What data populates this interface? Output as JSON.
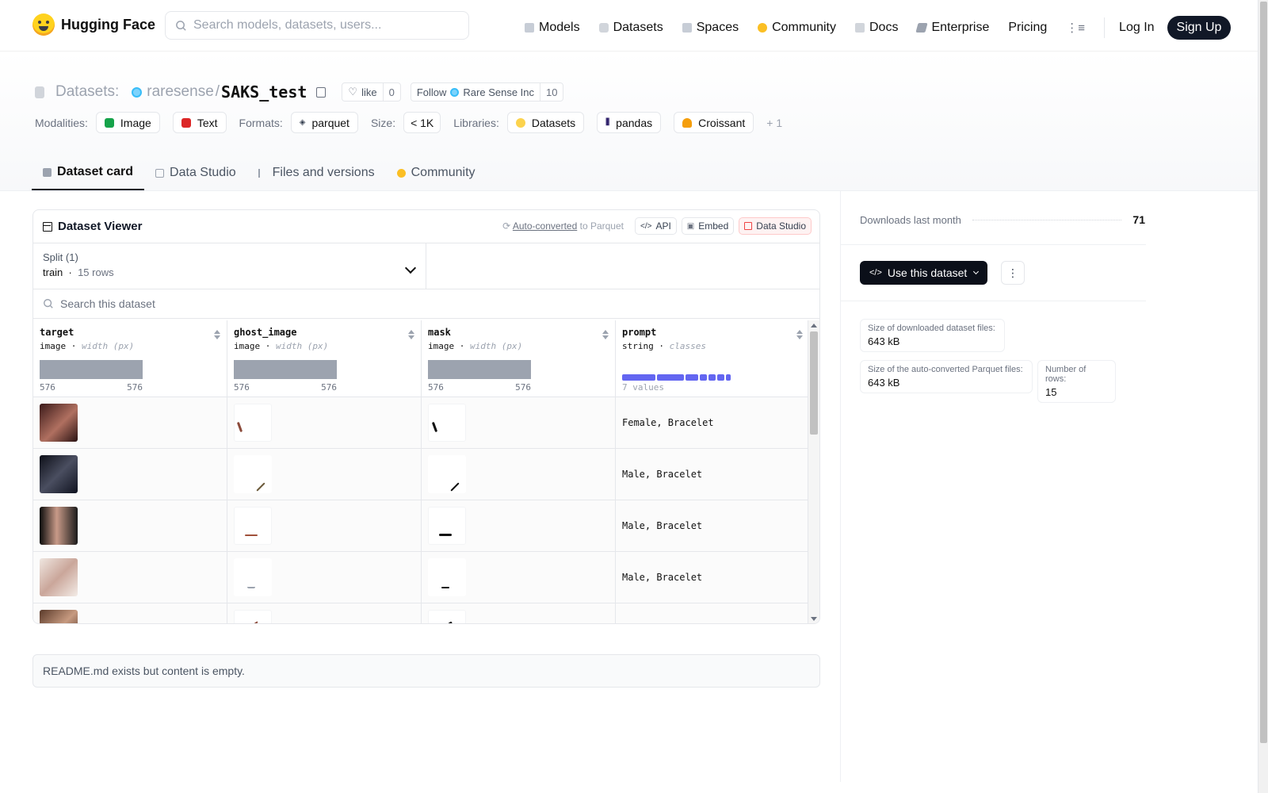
{
  "nav": {
    "brand": "Hugging Face",
    "search_placeholder": "Search models, datasets, users...",
    "links": [
      "Models",
      "Datasets",
      "Spaces",
      "Community",
      "Docs",
      "Enterprise",
      "Pricing"
    ],
    "login": "Log In",
    "signup": "Sign Up"
  },
  "header": {
    "section": "Datasets:",
    "owner": "raresense",
    "separator": "/",
    "repo": "SAKS_test",
    "like_label": "like",
    "like_count": "0",
    "follow_label": "Follow",
    "follow_org": "Rare Sense Inc",
    "follow_count": "10",
    "modalities_label": "Modalities:",
    "modalities": [
      "Image",
      "Text"
    ],
    "formats_label": "Formats:",
    "formats": [
      "parquet"
    ],
    "size_label": "Size:",
    "size": "< 1K",
    "libraries_label": "Libraries:",
    "libraries": [
      "Datasets",
      "pandas",
      "Croissant"
    ],
    "more_libraries": "+ 1"
  },
  "tabs": [
    "Dataset card",
    "Data Studio",
    "Files and versions",
    "Community"
  ],
  "viewer": {
    "title": "Dataset Viewer",
    "auto_converted": "Auto-converted",
    "to_parquet": "to Parquet",
    "api": "API",
    "embed": "Embed",
    "data_studio": "Data Studio",
    "split_label": "Split (1)",
    "split_name": "train",
    "split_rows": "15 rows",
    "search_placeholder": "Search this dataset",
    "columns": [
      {
        "name": "target",
        "dtype": "image",
        "stat": "width (px)",
        "min": "576",
        "max": "576"
      },
      {
        "name": "ghost_image",
        "dtype": "image",
        "stat": "width (px)",
        "min": "576",
        "max": "576"
      },
      {
        "name": "mask",
        "dtype": "image",
        "stat": "width (px)",
        "min": "576",
        "max": "576"
      },
      {
        "name": "prompt",
        "dtype": "string",
        "stat": "classes",
        "values_label": "7 values"
      }
    ],
    "rows": [
      {
        "prompt": "Female, Bracelet"
      },
      {
        "prompt": "Male, Bracelet"
      },
      {
        "prompt": "Male, Bracelet"
      },
      {
        "prompt": "Male, Bracelet"
      },
      {
        "prompt": ""
      }
    ]
  },
  "readme": "README.md exists but content is empty.",
  "sidebar": {
    "downloads_label": "Downloads last month",
    "downloads": "71",
    "use_dataset": "Use this dataset",
    "stats": [
      {
        "label": "Size of downloaded dataset files:",
        "value": "643 kB"
      },
      {
        "label": "Size of the auto-converted Parquet files:",
        "value": "643 kB"
      },
      {
        "label": "Number of rows:",
        "value": "15"
      }
    ]
  },
  "colors": {
    "accent": "#111827",
    "class_bar": "#6366f1",
    "signup_bg": "#111827"
  }
}
